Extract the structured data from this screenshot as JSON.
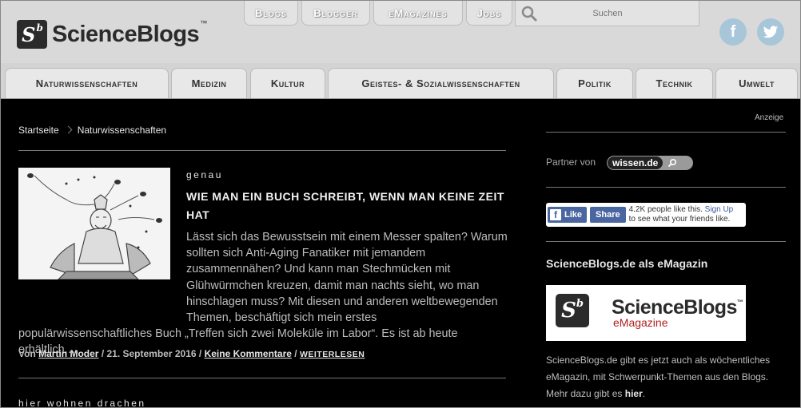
{
  "header": {
    "logo_glyph": "S",
    "logo_sup": "b",
    "logo_name": "ScienceBlogs",
    "logo_tm": "™",
    "top_tabs": [
      "Blogs",
      "Blogger",
      "eMagazines",
      "Jobs"
    ],
    "search_placeholder": "Suchen",
    "social_facebook": "f",
    "social_twitter": "t"
  },
  "nav": {
    "items": [
      "Naturwissenschaften",
      "Medizin",
      "Kultur",
      "Geistes- & Sozialwissenschaften",
      "Politik",
      "Technik",
      "Umwelt"
    ]
  },
  "breadcrumb": [
    "Startseite",
    "Naturwissenschaften"
  ],
  "article": {
    "kicker": "genau",
    "title": "Wie man ein Buch schreibt, wenn man keine Zeit hat",
    "excerpt": "Lässt sich das Bewusstsein mit einem Messer spalten? Warum sollten sich Anti-Aging Fanatiker mit jemandem zusammennähen? Und kann man Stechmücken mit Glühwürmchen kreuzen, damit man nachts sieht, wo man hinschlagen muss?   Mit diesen und anderen weltbewegenden Themen, beschäftigt sich mein erstes populärwissenschaftliches Buch „Treffen sich zwei Moleküle im Labor“. Es ist ab heute erhältlich,…",
    "meta_prefix": "Von",
    "author": "Martin Moder",
    "date": "/ 21. September 2016 /",
    "comments": "Keine Kommentare",
    "sep": "/",
    "read_more": "weiterlesen"
  },
  "next_article": {
    "kicker": "hier wohnen drachen"
  },
  "sidebar": {
    "ad_label": "Anzeige",
    "partner_label": "Partner von",
    "partner_logo": "wissen.de",
    "fb_like": "Like",
    "fb_share": "Share",
    "fb_count_text": "4.2K people like this.",
    "fb_signup": "Sign Up",
    "fb_tail": "to see what your friends like.",
    "emag_heading": "ScienceBlogs.de als eMagazin",
    "emag_logo_glyph": "S",
    "emag_logo_sup": "b",
    "emag_name": "ScienceBlogs",
    "emag_tm": "™",
    "emag_sub": "eMagazine",
    "emag_text": "ScienceBlogs.de gibt es jetzt auch als wöchentliches eMagazin, mit Schwerpunkt-Themen aus den Blogs. Mehr dazu gibt es",
    "emag_link": "hier",
    "emag_end": "."
  },
  "colors": {
    "background": "#000000",
    "header": "#d9d9d9",
    "social": "#a8c6d9",
    "fb_blue": "#4a66a0",
    "emag_red": "#b01e1e"
  }
}
